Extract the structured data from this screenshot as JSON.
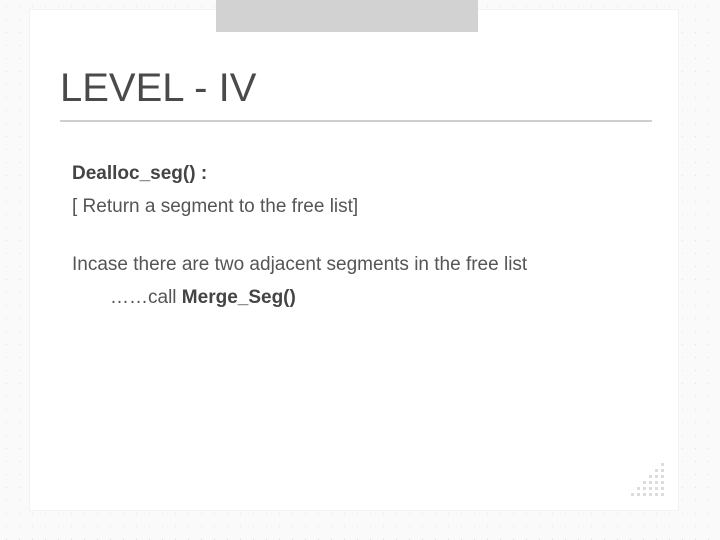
{
  "title": "LEVEL - IV",
  "dealloc_label": "Dealloc_seg() :",
  "dealloc_body": "[  Return a segment to the free list]",
  "incase_line1": "Incase there are two adjacent segments in the free list",
  "incase_prefix": "……call ",
  "merge_label": "Merge_Seg()"
}
